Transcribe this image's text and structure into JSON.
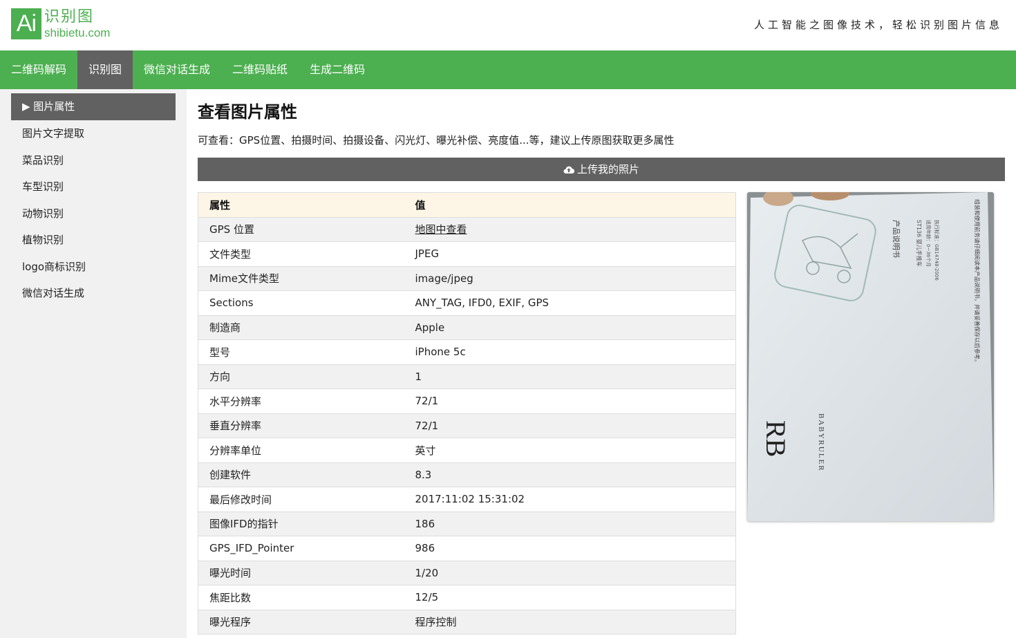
{
  "header": {
    "logo_mark": "Ai",
    "logo_cn": "识别图",
    "logo_en": "shibietu.com",
    "slogan": "人工智能之图像技术，轻松识别图片信息"
  },
  "nav": {
    "items": [
      "二维码解码",
      "识别图",
      "微信对话生成",
      "二维码贴纸",
      "生成二维码"
    ],
    "active_index": 1
  },
  "sidebar": {
    "active": "▶ 图片属性",
    "items": [
      "图片文字提取",
      "菜品识别",
      "车型识别",
      "动物识别",
      "植物识别",
      "logo商标识别",
      "微信对话生成"
    ]
  },
  "main": {
    "title": "查看图片属性",
    "description": "可查看：GPS位置、拍摄时间、拍摄设备、闪光灯、曝光补偿、亮度值...等，建议上传原图获取更多属性",
    "upload_label": "上传我的照片",
    "upload_icon": "cloud-upload-icon"
  },
  "table": {
    "headers": [
      "属性",
      "值"
    ],
    "rows": [
      [
        "GPS 位置",
        "地图中查看"
      ],
      [
        "文件类型",
        "JPEG"
      ],
      [
        "Mime文件类型",
        "image/jpeg"
      ],
      [
        "Sections",
        "ANY_TAG, IFD0, EXIF, GPS"
      ],
      [
        "制造商",
        "Apple"
      ],
      [
        "型号",
        "iPhone 5c"
      ],
      [
        "方向",
        "1"
      ],
      [
        "水平分辨率",
        "72/1"
      ],
      [
        "垂直分辨率",
        "72/1"
      ],
      [
        "分辨率单位",
        "英寸"
      ],
      [
        "创建软件",
        "8.3"
      ],
      [
        "最后修改时间",
        "2017:11:02 15:31:02"
      ],
      [
        "图像IFD的指针",
        "186"
      ],
      [
        "GPS_IFD_Pointer",
        "986"
      ],
      [
        "曝光时间",
        "1/20"
      ],
      [
        "焦距比数",
        "12/5"
      ],
      [
        "曝光程序",
        "程序控制"
      ]
    ]
  },
  "photo": {
    "brand": "BABYRULER",
    "product_line1": "产品说明书",
    "product_line2": "ST136 婴儿手推车",
    "product_line3": "适用年龄：0~36个月",
    "product_line4": "执行标准：GB14748-2006",
    "product_note": "组装和使用前务请仔细阅读本产品说明书，并请妥善保存以后参考。"
  },
  "colors": {
    "brand_green": "#4caf50",
    "nav_active": "#616161",
    "sidebar_bg": "#f1f1f1",
    "table_header_bg": "#fdf5e6"
  }
}
